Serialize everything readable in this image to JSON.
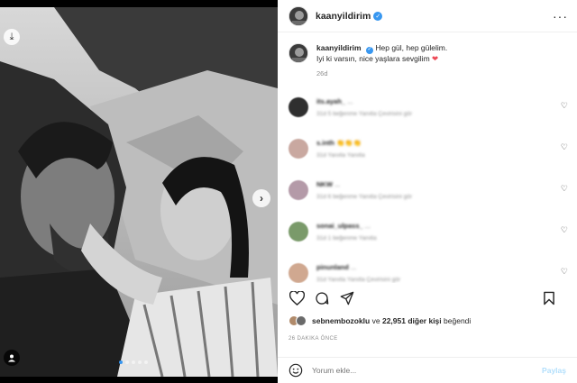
{
  "post": {
    "username": "kaanyildirim",
    "caption_user": "kaanyildirim",
    "caption_line1": "Hep gül, hep gülelim.",
    "caption_line2": "Iyi ki varsın, nice yaşlara sevgilim",
    "caption_heart": "❤",
    "caption_time": "26d"
  },
  "comments": [
    {
      "user": "its.ayah_",
      "text": "...",
      "meta": "31d  5 beğenme  Yanıtla  Çevirisini gör"
    },
    {
      "user": "s.inth",
      "text": "👏👏👏",
      "meta": "31d  Yanıtla  Yanıtla"
    },
    {
      "user": "NKW",
      "text": "...",
      "meta": "31d  6 beğenme  Yanıtla  Çevirisini gör"
    },
    {
      "user": "sonai_ulpass_",
      "text": "...",
      "meta": "31d  1 beğenme  Yanıtla"
    },
    {
      "user": "pinunland",
      "text": "...",
      "meta": "31d  Yanıtla  Yanıtla  Çevirisini gör"
    }
  ],
  "likes": {
    "first_user": "sebnembozoklu",
    "connector": "ve",
    "others": "22,951 diğer kişi",
    "suffix": "beğendi"
  },
  "post_time": "26 DAKIKA ÖNCE",
  "comment_input": {
    "placeholder": "Yorum ekle..."
  },
  "post_button": "Paylaş",
  "colors": {
    "verified": "#3897f0",
    "heart": "#ed4956",
    "post_disabled": "#b2dffc"
  }
}
